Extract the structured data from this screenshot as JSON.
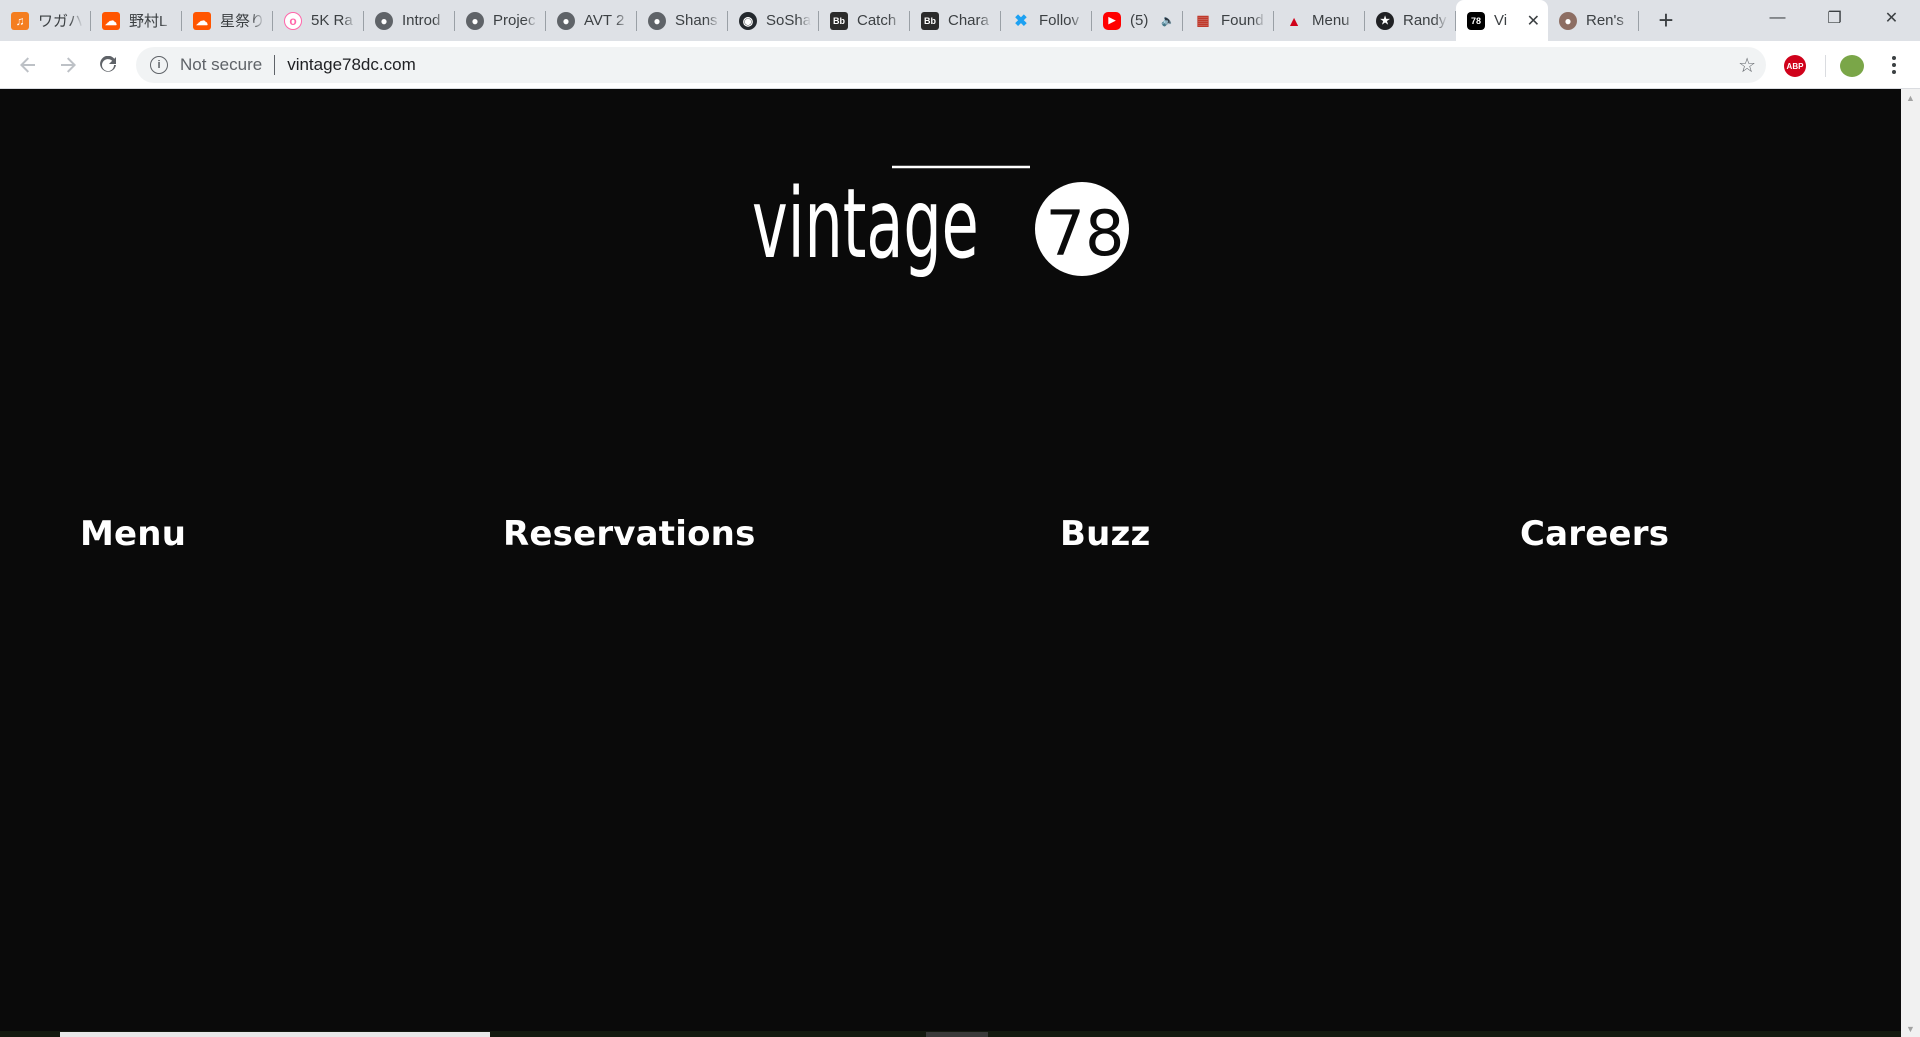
{
  "browser": {
    "tabs": [
      {
        "title": "ワガハ",
        "icon": "headphones-icon",
        "color": "#f47e20"
      },
      {
        "title": "野村L",
        "icon": "soundcloud-icon",
        "color": "#ff5500"
      },
      {
        "title": "星祭り",
        "icon": "soundcloud-icon",
        "color": "#ff5500"
      },
      {
        "title": "5K Ra",
        "icon": "osu-icon",
        "color": "#ff66aa"
      },
      {
        "title": "Introd",
        "icon": "globe-icon",
        "color": "#5f6368"
      },
      {
        "title": "Projec",
        "icon": "globe-icon",
        "color": "#5f6368"
      },
      {
        "title": "AVT 2",
        "icon": "globe-icon",
        "color": "#5f6368"
      },
      {
        "title": "Shans",
        "icon": "globe-icon",
        "color": "#5f6368"
      },
      {
        "title": "SoSha",
        "icon": "github-icon",
        "color": "#24292e"
      },
      {
        "title": "Catch",
        "icon": "blackboard-icon",
        "color": "#2b2b2b"
      },
      {
        "title": "Chara",
        "icon": "blackboard-icon",
        "color": "#2b2b2b"
      },
      {
        "title": "Follov",
        "icon": "feather-icon",
        "color": "#1da1f2"
      },
      {
        "title": "(5)",
        "icon": "youtube-icon",
        "color": "#ff0000"
      },
      {
        "title": "Found",
        "icon": "bar-icon",
        "color": "#c0392b"
      },
      {
        "title": "Menu",
        "icon": "tableau-icon",
        "color": "#d0021b"
      },
      {
        "title": "Randy",
        "icon": "star-badge-icon",
        "color": "#202124"
      },
      {
        "title": "Vi",
        "icon": "vintage78-icon",
        "color": "#000000"
      },
      {
        "title": "Ren's",
        "icon": "ren-icon",
        "color": "#8d6e63"
      }
    ],
    "new_tab_label": "+",
    "window": {
      "minimize": "—",
      "restore": "❐",
      "close": "✕"
    },
    "security_label": "Not secure",
    "url": "vintage78dc.com"
  },
  "page": {
    "brand": {
      "word": "vintage",
      "number": "78"
    },
    "nav": {
      "menu": "Menu",
      "reservations": "Reservations",
      "buzz": "Buzz",
      "careers": "Careers"
    }
  }
}
